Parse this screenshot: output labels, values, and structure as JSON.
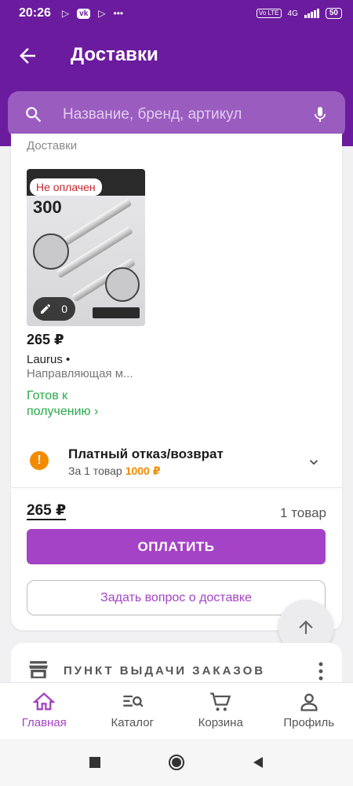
{
  "status_bar": {
    "time": "20:26",
    "network": "4G",
    "battery": "50",
    "volte": "Vo LTE"
  },
  "header": {
    "title": "Доставки",
    "back_icon": "arrow-left-icon"
  },
  "search": {
    "placeholder": "Название, бренд, артикул",
    "icon": "search-icon",
    "mic_icon": "microphone-icon"
  },
  "delivery": {
    "section_label": "Доставки",
    "item": {
      "status_chip": "Не оплачен",
      "image_number": "300",
      "review_count": "0",
      "price": "265 ₽",
      "brand": "Laurus",
      "name": "Направляющая м...",
      "ready_status": "Готов к получению ›"
    },
    "paid_return": {
      "title": "Платный отказ/возврат",
      "subtitle": "За 1 товар",
      "fee": "1000 ₽"
    },
    "total": "265 ₽",
    "count": "1 товар",
    "pay_button": "ОПЛАТИТЬ",
    "ask_button": "Задать вопрос о доставке"
  },
  "pickup_section": {
    "title": "ПУНКТ ВЫДАЧИ ЗАКАЗОВ"
  },
  "bottom_nav": [
    {
      "label": "Главная",
      "icon": "home-icon",
      "active": true
    },
    {
      "label": "Каталог",
      "icon": "catalog-icon",
      "active": false
    },
    {
      "label": "Корзина",
      "icon": "cart-icon",
      "active": false
    },
    {
      "label": "Профиль",
      "icon": "profile-icon",
      "active": false
    }
  ],
  "colors": {
    "brand_purple": "#6b1c9e",
    "accent": "#a443c5",
    "ready_green": "#2aa84a",
    "warning_orange": "#f28b00",
    "unpaid_red": "#c4262b"
  }
}
